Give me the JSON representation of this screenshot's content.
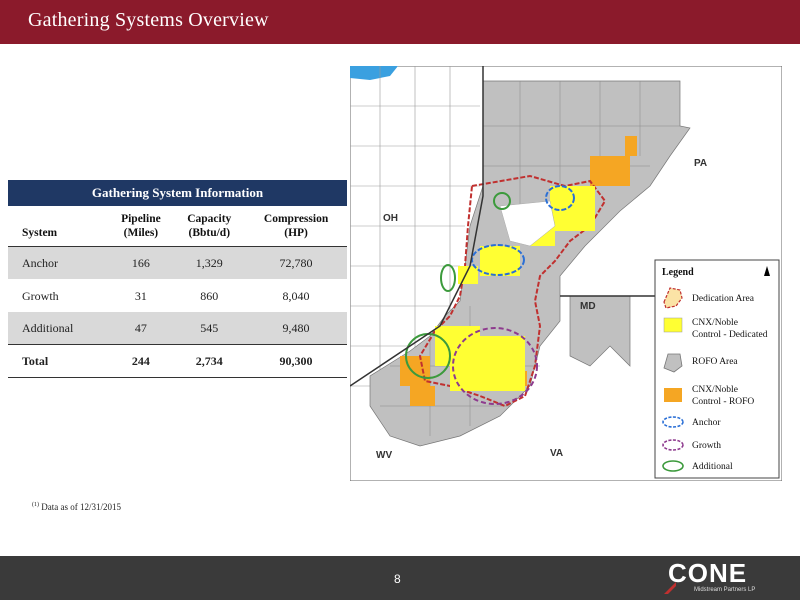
{
  "header": {
    "title": "Gathering Systems Overview"
  },
  "table": {
    "title": "Gathering System Information",
    "columns": [
      "System",
      [
        "Pipeline",
        "(Miles)"
      ],
      [
        "Capacity",
        "(Bbtu/d)"
      ],
      [
        "Compression",
        "(HP)"
      ]
    ],
    "rows": [
      {
        "system": "Anchor",
        "pipeline": "166",
        "capacity": "1,329",
        "compression": "72,780"
      },
      {
        "system": "Growth",
        "pipeline": "31",
        "capacity": "860",
        "compression": "8,040"
      },
      {
        "system": "Additional",
        "pipeline": "47",
        "capacity": "545",
        "compression": "9,480"
      }
    ],
    "total": {
      "system": "Total",
      "pipeline": "244",
      "capacity": "2,734",
      "compression": "90,300"
    }
  },
  "footnote": {
    "marker": "(1)",
    "text": "Data as of 12/31/2015"
  },
  "map": {
    "states": {
      "oh": "OH",
      "pa": "PA",
      "md": "MD",
      "wv": "WV",
      "va": "VA"
    },
    "legend": {
      "title": "Legend",
      "items": [
        {
          "label": "Dedication Area",
          "icon": "dedication-area-swatch"
        },
        {
          "label": "CNX/Noble Control - Dedicated",
          "icon": "dedicated-swatch",
          "color": "#ffff33"
        },
        {
          "label": "ROFO Area",
          "icon": "rofo-area-swatch",
          "color": "#c0c0c0"
        },
        {
          "label": "CNX/Noble Control - ROFO",
          "icon": "rofo-swatch",
          "color": "#f5a623"
        },
        {
          "label": "Anchor",
          "icon": "anchor-ellipse",
          "color": "#2a6fd6"
        },
        {
          "label": "Growth",
          "icon": "growth-ellipse",
          "color": "#8e3a8e"
        },
        {
          "label": "Additional",
          "icon": "additional-ellipse",
          "color": "#3c9a3c"
        }
      ],
      "l1": "Dedication Area",
      "l2a": "CNX/Noble",
      "l2b": "Control - Dedicated",
      "l3": "ROFO Area",
      "l4a": "CNX/Noble",
      "l4b": "Control - ROFO",
      "l5": "Anchor",
      "l6": "Growth",
      "l7": "Additional"
    }
  },
  "footer": {
    "page": "8",
    "logo_name": "CONE",
    "logo_sub": "Midstream Partners LP"
  },
  "colors": {
    "brand": "#8b1a2b",
    "table_header": "#1f3864",
    "footer": "#3a3a3a"
  }
}
